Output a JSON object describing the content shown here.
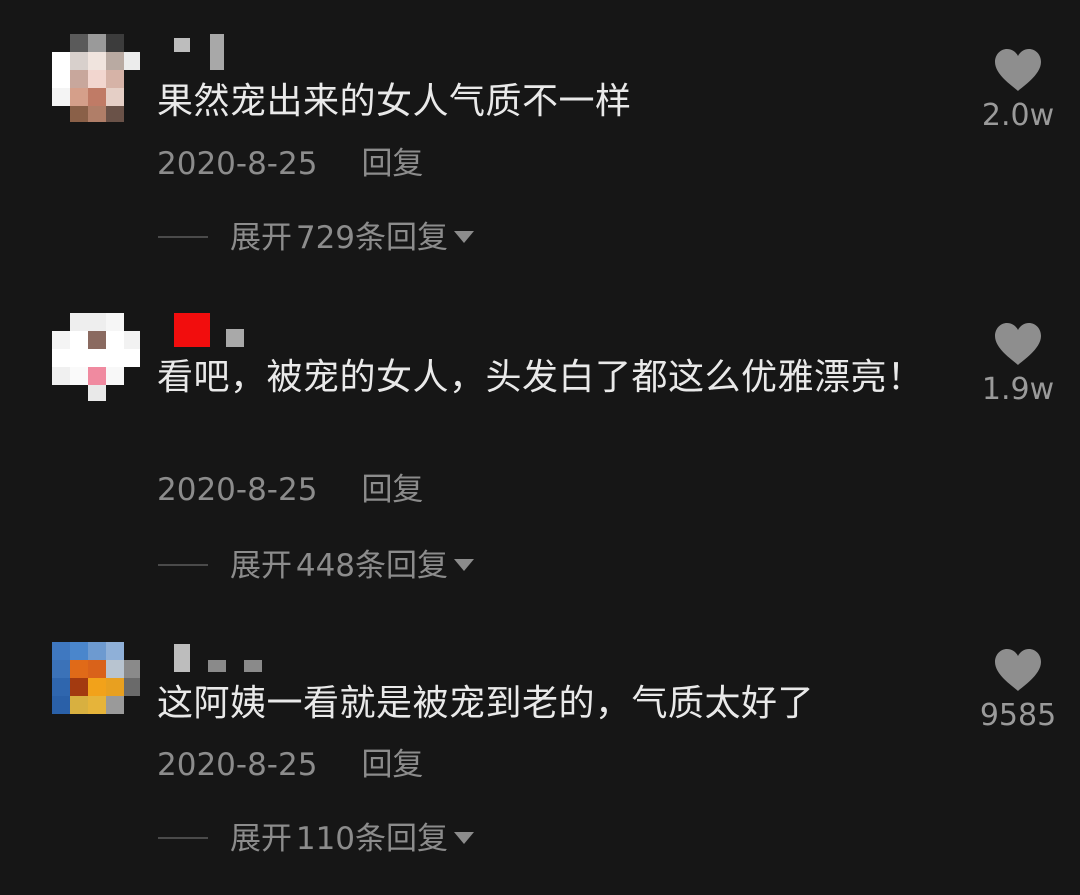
{
  "comments": [
    {
      "text": "果然宠出来的女人气质不一样",
      "date": "2020-8-25",
      "reply_label": "回复",
      "expand_prefix": "展开",
      "expand_count": "729",
      "expand_suffix": "条回复",
      "likes": "2.0w",
      "like_icon": "heart-icon",
      "expand_icon": "caret-down-icon"
    },
    {
      "text": "看吧，被宠的女人，头发白了都这么优雅漂亮！",
      "date": "2020-8-25",
      "reply_label": "回复",
      "expand_prefix": "展开",
      "expand_count": "448",
      "expand_suffix": "条回复",
      "likes": "1.9w",
      "like_icon": "heart-icon",
      "expand_icon": "caret-down-icon"
    },
    {
      "text": "这阿姨一看就是被宠到老的，气质太好了",
      "date": "2020-8-25",
      "reply_label": "回复",
      "expand_prefix": "展开",
      "expand_count": "110",
      "expand_suffix": "条回复",
      "likes": "9585",
      "like_icon": "heart-icon",
      "expand_icon": "caret-down-icon"
    }
  ],
  "colors": {
    "background": "#161616",
    "text_primary": "#e9e9e9",
    "text_secondary": "#8c8c8c",
    "heart": "#8e8e8e"
  }
}
